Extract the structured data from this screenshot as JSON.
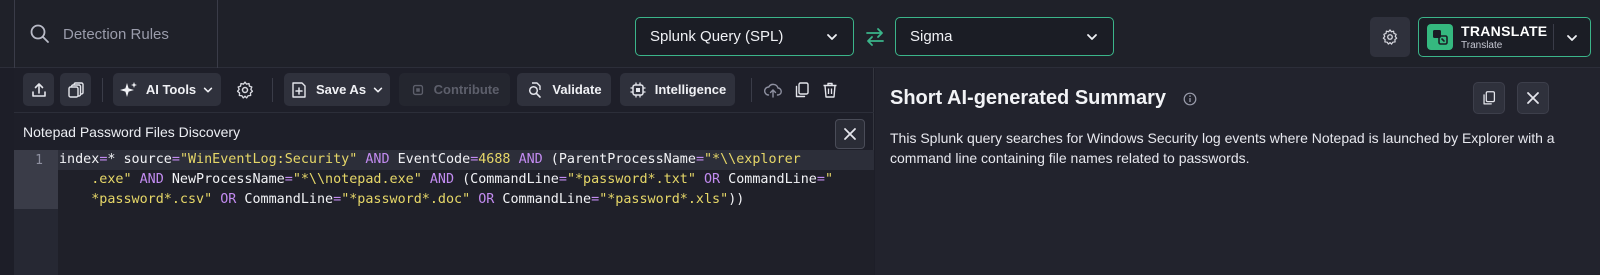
{
  "header": {
    "search_placeholder": "Detection Rules",
    "source_language": "Splunk Query (SPL)",
    "target_language": "Sigma",
    "translate_label": "TRANSLATE",
    "translate_sublabel": "Translate"
  },
  "toolbar": {
    "ai_tools_label": "AI Tools",
    "save_as_label": "Save As",
    "contribute_label": "Contribute",
    "validate_label": "Validate",
    "intelligence_label": "Intelligence"
  },
  "editor": {
    "query_title": "Notepad Password Files Discovery",
    "line_number": "1"
  },
  "summary": {
    "title": "Short AI-generated Summary",
    "text": "This Splunk query searches for Windows Security log events where Notepad is launched by Explorer with a command line containing file names related to passwords."
  },
  "colors": {
    "accent_green": "#3bb58a",
    "string_yellow": "#e6d768",
    "operator_purple": "#c28bf0"
  },
  "icons": [
    "search-icon",
    "chevron-down-icon",
    "swap-icon",
    "gear-icon",
    "translate-icon",
    "upload-icon",
    "stack-icon",
    "sparkles-icon",
    "save-icon",
    "chip-icon",
    "validate-icon",
    "cloud-upload-icon",
    "copy-icon",
    "trash-icon",
    "close-icon",
    "info-icon"
  ]
}
